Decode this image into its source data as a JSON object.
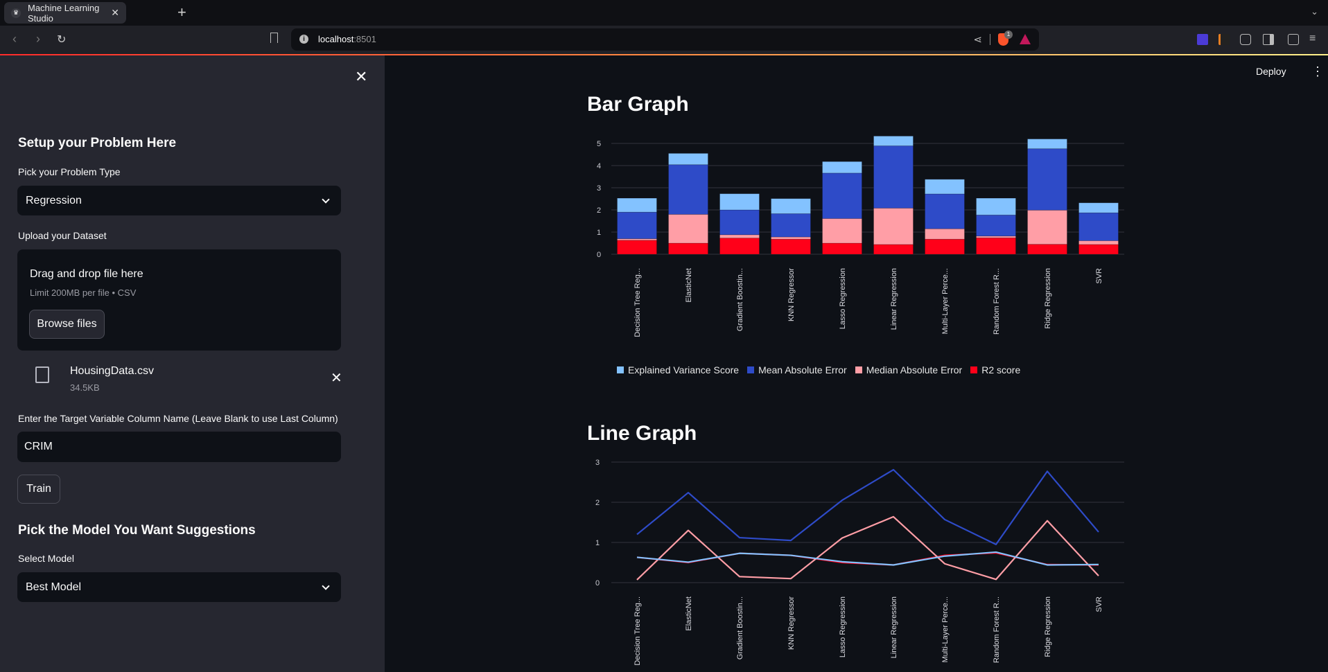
{
  "browser": {
    "tab_title": "Machine Learning Studio",
    "tab_favicon": "streamlit-crown-icon",
    "new_tab_label": "+",
    "url_host": "localhost",
    "url_port": ":8501",
    "brave_badge_count": "1"
  },
  "app": {
    "deploy_label": "Deploy",
    "menu_icon": "⋮"
  },
  "sidebar": {
    "close_icon": "✕",
    "setup_heading": "Setup your Problem Here",
    "problem_type_label": "Pick your Problem Type",
    "problem_type_value": "Regression",
    "upload_label": "Upload your Dataset",
    "dropzone_title": "Drag and drop file here",
    "dropzone_limit": "Limit 200MB per file • CSV",
    "browse_label": "Browse files",
    "file_name": "HousingData.csv",
    "file_size": "34.5KB",
    "file_remove_icon": "✕",
    "target_label": "Enter the Target Variable Column Name (Leave Blank to use Last Column)",
    "target_value": "CRIM",
    "train_label": "Train",
    "suggest_heading": "Pick the Model You Want Suggestions",
    "select_model_label": "Select Model",
    "select_model_value": "Best Model"
  },
  "main": {
    "bar_title": "Bar Graph",
    "line_title": "Line Graph"
  },
  "chart_data": [
    {
      "type": "bar",
      "stacked": true,
      "title": "Bar Graph",
      "categories": [
        "Decision Tree Reg...",
        "ElasticNet",
        "Gradient Boostin...",
        "KNN Regressor",
        "Lasso Regression",
        "Linear Regression",
        "Multi-Layer Perce...",
        "Random Forest R...",
        "Ridge Regression",
        "SVR"
      ],
      "ylim": [
        0,
        5.4
      ],
      "yticks": [
        0,
        1,
        2,
        3,
        4,
        5
      ],
      "grid": true,
      "legend_position": "bottom",
      "series": [
        {
          "name": "R2 score",
          "color": "#ff0019",
          "values": [
            0.63,
            0.5,
            0.73,
            0.68,
            0.5,
            0.44,
            0.68,
            0.74,
            0.45,
            0.44
          ]
        },
        {
          "name": "Median Absolute Error",
          "color": "#ff9ea6",
          "values": [
            0.07,
            1.3,
            0.15,
            0.1,
            1.11,
            1.64,
            0.47,
            0.08,
            1.54,
            0.17
          ]
        },
        {
          "name": "Mean Absolute Error",
          "color": "#2e4bc8",
          "values": [
            1.2,
            2.24,
            1.12,
            1.05,
            2.05,
            2.81,
            1.57,
            0.95,
            2.77,
            1.26
          ]
        },
        {
          "name": "Explained Variance Score",
          "color": "#83c2ff",
          "values": [
            0.63,
            0.51,
            0.73,
            0.68,
            0.52,
            0.44,
            0.66,
            0.76,
            0.44,
            0.45
          ]
        }
      ],
      "legend_order": [
        "Explained Variance Score",
        "Mean Absolute Error",
        "Median Absolute Error",
        "R2 score"
      ]
    },
    {
      "type": "line",
      "title": "Line Graph",
      "categories": [
        "Decision Tree Reg...",
        "ElasticNet",
        "Gradient Boostin...",
        "KNN Regressor",
        "Lasso Regression",
        "Linear Regression",
        "Multi-Layer Perce...",
        "Random Forest R...",
        "Ridge Regression",
        "SVR"
      ],
      "ylim": [
        0,
        3.1
      ],
      "yticks": [
        0,
        1,
        2,
        3
      ],
      "grid": true,
      "series": [
        {
          "name": "R2 score",
          "color": "#ff0019",
          "values": [
            0.63,
            0.5,
            0.73,
            0.68,
            0.5,
            0.44,
            0.68,
            0.74,
            0.45,
            0.44
          ]
        },
        {
          "name": "Median Absolute Error",
          "color": "#ff9ea6",
          "values": [
            0.07,
            1.3,
            0.15,
            0.1,
            1.11,
            1.64,
            0.47,
            0.08,
            1.54,
            0.17
          ]
        },
        {
          "name": "Mean Absolute Error",
          "color": "#2e4bc8",
          "values": [
            1.2,
            2.24,
            1.12,
            1.05,
            2.05,
            2.81,
            1.57,
            0.95,
            2.77,
            1.26
          ]
        },
        {
          "name": "Explained Variance Score",
          "color": "#83c2ff",
          "values": [
            0.63,
            0.51,
            0.73,
            0.68,
            0.52,
            0.44,
            0.66,
            0.76,
            0.44,
            0.45
          ]
        }
      ]
    }
  ]
}
